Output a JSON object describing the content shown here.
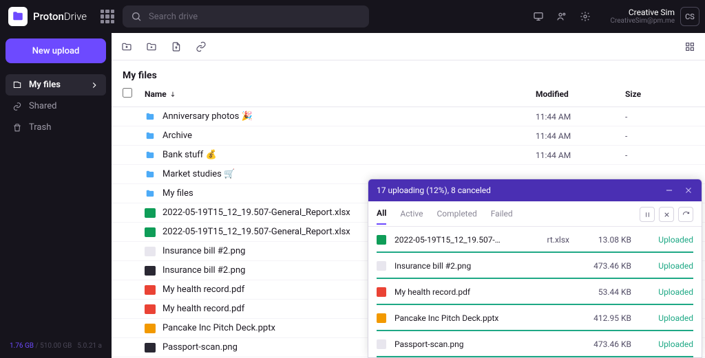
{
  "brand": {
    "name1": "Proton",
    "name2": "Drive"
  },
  "search": {
    "placeholder": "Search drive"
  },
  "user": {
    "name": "Creative Sim",
    "email": "CreativeSim@pm.me",
    "initials": "CS"
  },
  "sidebar": {
    "new_upload": "New upload",
    "items": [
      {
        "label": "My files",
        "active": true,
        "icon": "files"
      },
      {
        "label": "Shared",
        "active": false,
        "icon": "link"
      },
      {
        "label": "Trash",
        "active": false,
        "icon": "trash"
      }
    ],
    "storage_used": "1.76 GB",
    "storage_sep": " / ",
    "storage_total": "510.00 GB",
    "version": "5.0.21 a"
  },
  "page": {
    "title": "My files"
  },
  "columns": {
    "name": "Name",
    "modified": "Modified",
    "size": "Size"
  },
  "rows": [
    {
      "icon": "folder",
      "name": "Anniversary photos 🎉",
      "modified": "11:44 AM",
      "size": "-"
    },
    {
      "icon": "folder",
      "name": "Archive",
      "modified": "11:44 AM",
      "size": "-"
    },
    {
      "icon": "folder",
      "name": "Bank stuff 💰",
      "modified": "11:44 AM",
      "size": "-"
    },
    {
      "icon": "folder",
      "name": "Market studies 🛒",
      "modified": "",
      "size": ""
    },
    {
      "icon": "folder",
      "name": "My files",
      "modified": "",
      "size": ""
    },
    {
      "icon": "xls",
      "name": "2022-05-19T15_12_19.507-General_Report.xlsx",
      "modified": "",
      "size": ""
    },
    {
      "icon": "xls",
      "name": "2022-05-19T15_12_19.507-General_Report.xlsx",
      "modified": "",
      "size": ""
    },
    {
      "icon": "img-light",
      "name": "Insurance bill #2.png",
      "modified": "",
      "size": ""
    },
    {
      "icon": "img-dark",
      "name": "Insurance bill #2.png",
      "modified": "",
      "size": ""
    },
    {
      "icon": "pdf",
      "name": "My health record.pdf",
      "modified": "",
      "size": ""
    },
    {
      "icon": "pdf",
      "name": "My health record.pdf",
      "modified": "",
      "size": ""
    },
    {
      "icon": "ppt",
      "name": "Pancake Inc Pitch Deck.pptx",
      "modified": "",
      "size": ""
    },
    {
      "icon": "img-dark",
      "name": "Passport-scan.png",
      "modified": "",
      "size": ""
    }
  ],
  "upload": {
    "header": "17 uploading (12%), 8 canceled",
    "tabs": {
      "all": "All",
      "active": "Active",
      "completed": "Completed",
      "failed": "Failed"
    },
    "items": [
      {
        "icon": "xls",
        "name": "2022-05-19T15_12_19.507-…",
        "ext": "rt.xlsx",
        "size": "13.08 KB",
        "status": "Uploaded"
      },
      {
        "icon": "img-light",
        "name": "Insurance bill #2.png",
        "ext": "",
        "size": "473.46 KB",
        "status": "Uploaded"
      },
      {
        "icon": "pdf",
        "name": "My health record.pdf",
        "ext": "",
        "size": "53.44 KB",
        "status": "Uploaded"
      },
      {
        "icon": "ppt",
        "name": "Pancake Inc Pitch Deck.pptx",
        "ext": "",
        "size": "412.95 KB",
        "status": "Uploaded"
      },
      {
        "icon": "img-light",
        "name": "Passport-scan.png",
        "ext": "",
        "size": "473.46 KB",
        "status": "Uploaded"
      }
    ]
  }
}
